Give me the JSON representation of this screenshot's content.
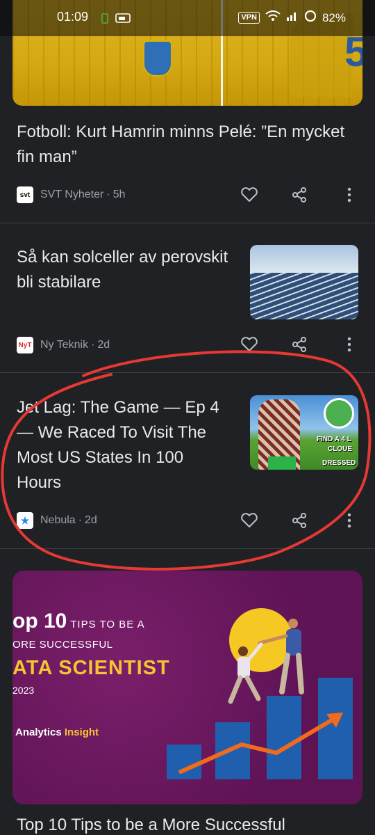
{
  "status_bar": {
    "time": "01:09",
    "vpn": "VPN",
    "battery": "82%"
  },
  "articles": [
    {
      "title": "Fotboll: Kurt Hamrin minns Pelé: ”En mycket fin man”",
      "source": "SVT Nyheter",
      "age": "5h",
      "logo_text": "svt"
    },
    {
      "title": "Så kan solceller av perovskit bli stabilare",
      "source": "Ny Teknik",
      "age": "2d",
      "logo_text": "NyT"
    },
    {
      "title": "Jet Lag: The Game — Ep 4 — We Raced To Visit The Most US States In 100 Hours",
      "source": "Nebula",
      "age": "2d",
      "logo_text": "★",
      "thumb_text": [
        "FIND A 4 L",
        "CLOUE",
        "DRESSED"
      ]
    }
  ],
  "feature_card": {
    "line1_big": "op 10",
    "line1_small": " TIPS TO BE A",
    "line2": "ORE SUCCESSFUL",
    "line3": "ATA SCIENTIST",
    "line4": "2023",
    "brand_a": "Analytics ",
    "brand_b": "Insight",
    "title": "Top 10 Tips to be a More Successful"
  },
  "separator": "·",
  "colors": {
    "background": "#202124",
    "annotation": "#e53935"
  }
}
